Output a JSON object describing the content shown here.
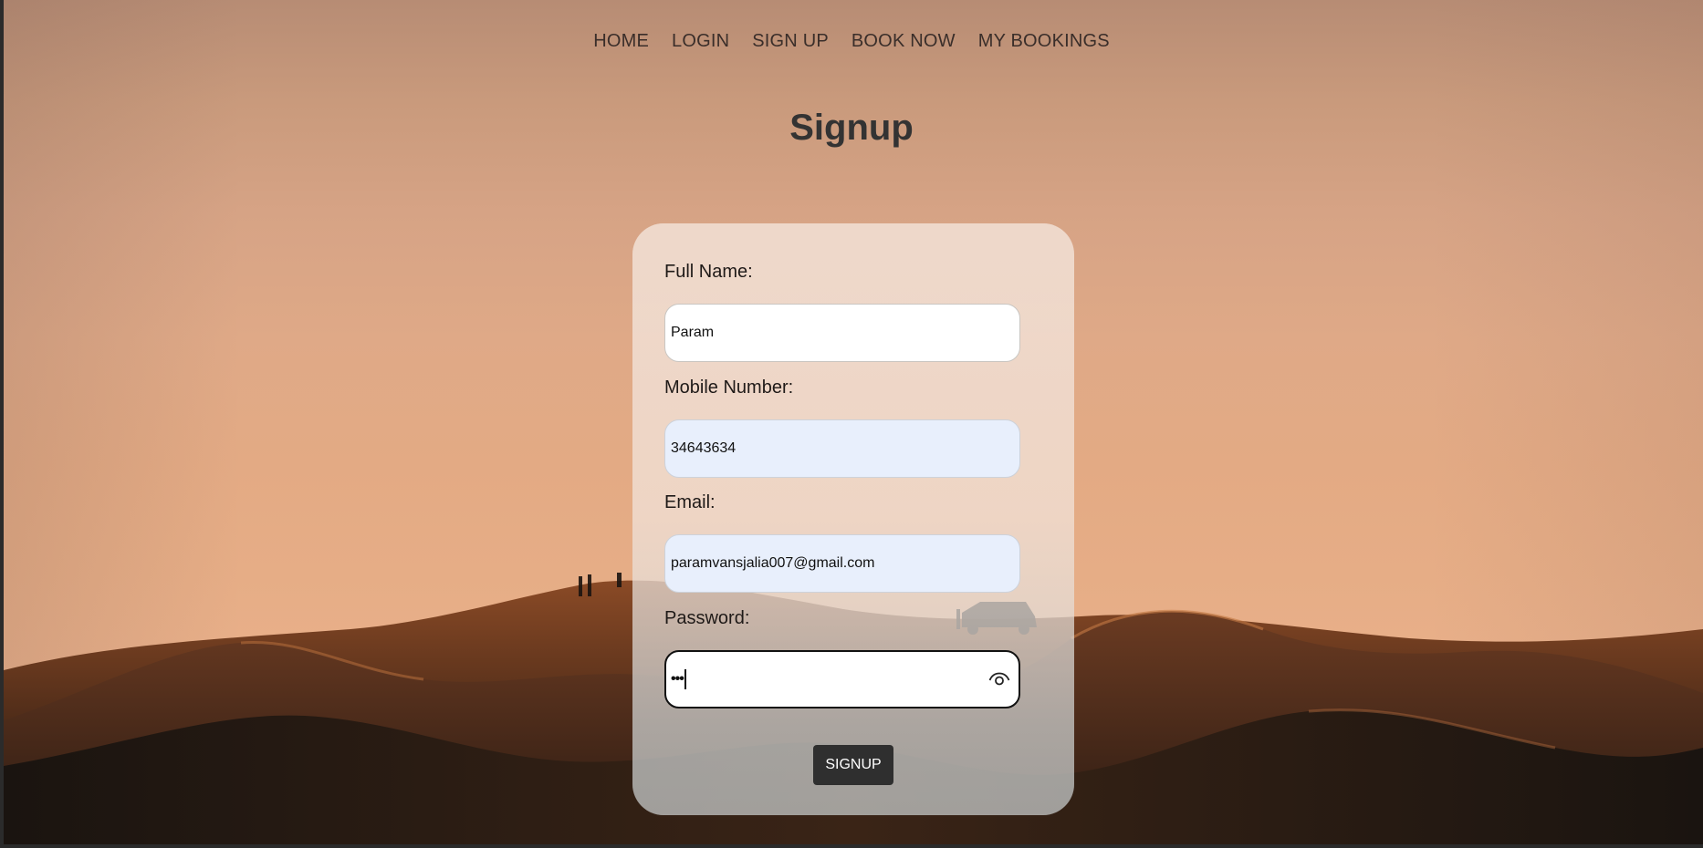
{
  "nav": {
    "items": [
      "HOME",
      "LOGIN",
      "SIGN UP",
      "BOOK NOW",
      "MY BOOKINGS"
    ]
  },
  "page": {
    "title": "Signup"
  },
  "form": {
    "full_name": {
      "label": "Full Name:",
      "value": "Param"
    },
    "mobile": {
      "label": "Mobile Number:",
      "value": "34643634"
    },
    "email": {
      "label": "Email:",
      "value": "paramvansjalia007@gmail.com"
    },
    "password": {
      "label": "Password:",
      "masked_value": "•••"
    },
    "submit_label": "SIGNUP"
  },
  "icons": {
    "password_toggle": "eye-icon"
  }
}
